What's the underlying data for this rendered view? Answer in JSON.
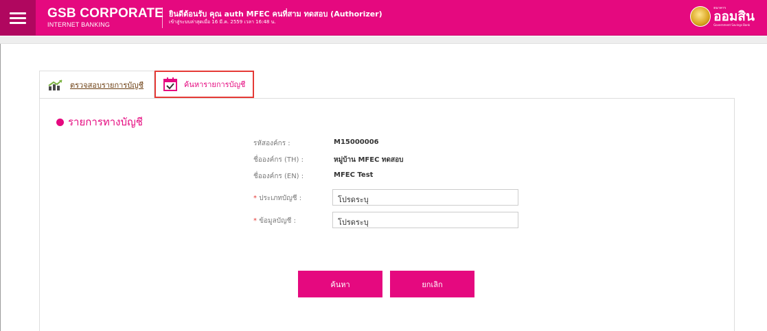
{
  "header": {
    "brand_title": "GSB CORPORATE",
    "brand_sub": "INTERNET BANKING",
    "welcome": "ยินดีต้อนรับ คุณ auth MFEC คนที่สาม ทดสอบ (Authorizer)",
    "last_login": "เข้าสู่ระบบล่าสุดเมื่อ 16 มี.ค. 2559 เวลา 16:48 น.",
    "logo_small": "ธนาคาร",
    "logo_main": "ออมสิน",
    "logo_eng": "Government Savings Bank",
    "color_brand": "#e5097f"
  },
  "tabs": [
    {
      "label": "ตรวจสอบรายการบัญชี",
      "icon": "chart-icon"
    },
    {
      "label": "ค้นหารายการบัญชี",
      "icon": "calendar-check-icon"
    }
  ],
  "section": {
    "title": "รายการทางบัญชี"
  },
  "form": {
    "org_code_label": "รหัสองค์กร :",
    "org_code_value": "M15000006",
    "org_name_th_label": "ชื่อองค์กร (TH) :",
    "org_name_th_value": "หมู่บ้าน MFEC ทดสอบ",
    "org_name_en_label": "ชื่อองค์กร (EN) :",
    "org_name_en_value": "MFEC Test",
    "required_mark": "*",
    "account_type_label": "ประเภทบัญชี :",
    "account_type_value": "โปรดระบุ",
    "account_info_label": "ข้อมูลบัญชี :",
    "account_info_value": "โปรดระบุ"
  },
  "buttons": {
    "search": "ค้นหา",
    "cancel": "ยกเลิก"
  }
}
